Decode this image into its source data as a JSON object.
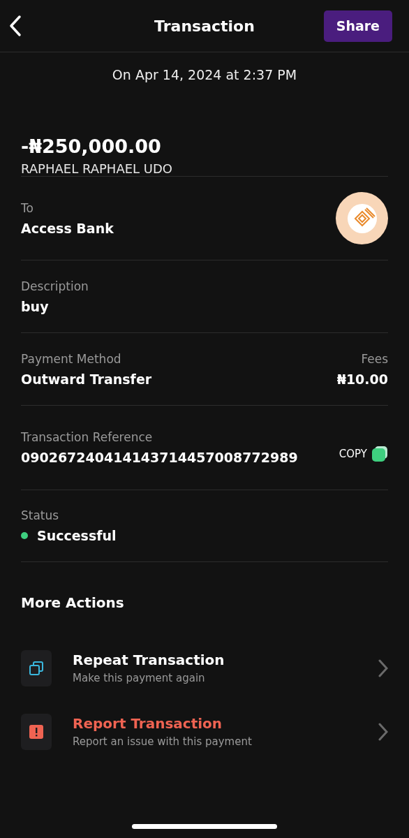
{
  "header": {
    "title": "Transaction",
    "share": "Share"
  },
  "date": "On Apr 14, 2024 at 2:37 PM",
  "amount": "-₦250,000.00",
  "counterparty": "RAPHAEL RAPHAEL UDO",
  "details": [
    {
      "kind": "bank",
      "label": "To",
      "value": "Access Bank"
    },
    {
      "kind": "plain",
      "label": "Description",
      "value": "buy"
    },
    {
      "kind": "pair",
      "label": "Payment Method",
      "value": "Outward Transfer",
      "side_label": "Fees",
      "side_value": "₦10.00"
    },
    {
      "kind": "copy",
      "label": "Transaction Reference",
      "value": "090267240414143714457008772989",
      "action": "COPY"
    },
    {
      "kind": "status",
      "label": "Status",
      "value": "Successful",
      "color": "#3ecf7f"
    }
  ],
  "more_actions": {
    "title": "More Actions",
    "items": [
      {
        "kind": "repeat",
        "title": "Repeat Transaction",
        "subtitle": "Make this payment again"
      },
      {
        "kind": "report",
        "title": "Report Transaction",
        "subtitle": "Report an issue with this payment"
      }
    ]
  }
}
